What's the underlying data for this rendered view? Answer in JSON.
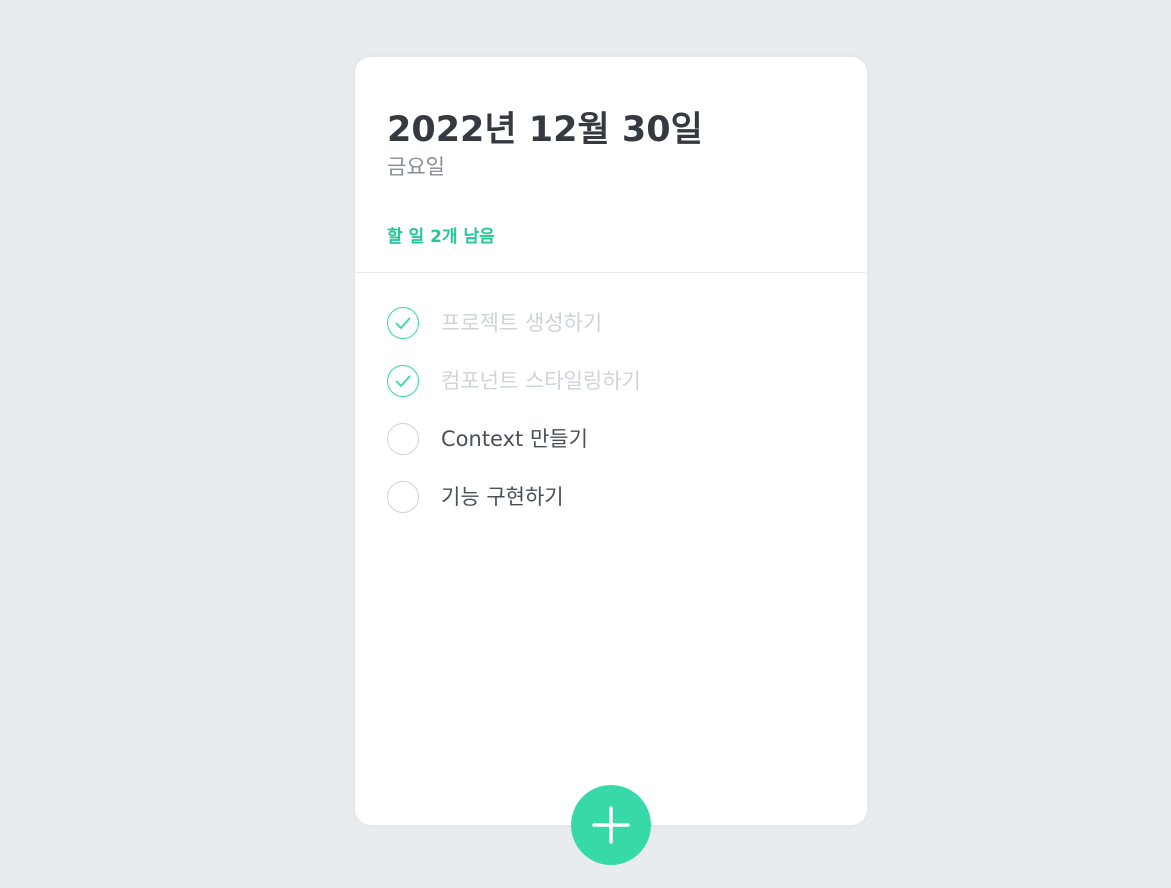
{
  "header": {
    "date": "2022년 12월 30일",
    "day": "금요일",
    "tasks_left": "할 일 2개 남음"
  },
  "todos": [
    {
      "text": "프로젝트 생성하기",
      "done": true
    },
    {
      "text": "컴포넌트 스타일링하기",
      "done": true
    },
    {
      "text": "Context 만들기",
      "done": false
    },
    {
      "text": "기능 구현하기",
      "done": false
    }
  ],
  "icons": {
    "check": "check-icon",
    "add": "plus-icon"
  },
  "colors": {
    "accent": "#38d9a9",
    "accent_text": "#20c997",
    "background": "#e9ecef",
    "done_text": "#ced4da"
  }
}
